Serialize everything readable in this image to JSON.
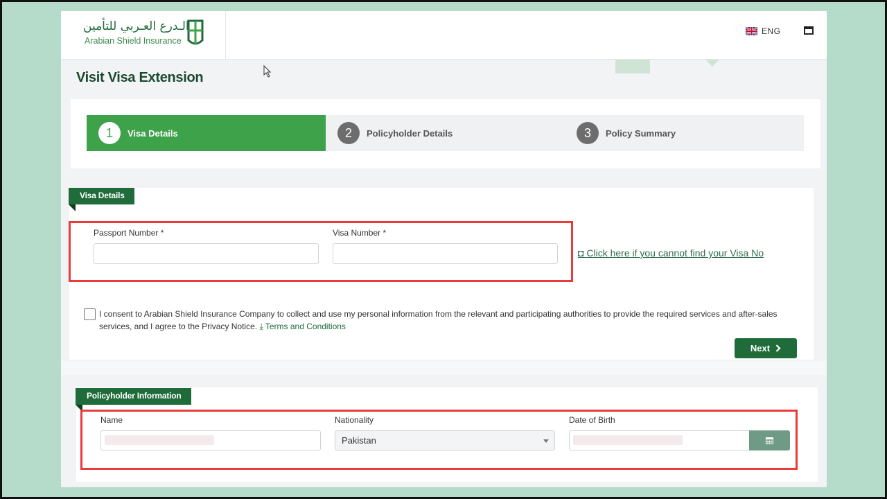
{
  "brand": {
    "name_ar": "الـدرع العـربي للتأمين",
    "name_en": "Arabian Shield Insurance"
  },
  "header": {
    "language": "ENG",
    "flag_icon": "uk-flag-icon",
    "window_icon": "window-icon"
  },
  "page_title": "Visit Visa Extension",
  "steps": [
    {
      "number": "1",
      "label": "Visa Details",
      "active": true
    },
    {
      "number": "2",
      "label": "Policyholder Details",
      "active": false
    },
    {
      "number": "3",
      "label": "Policy Summary",
      "active": false
    }
  ],
  "visa_details": {
    "section_title": "Visa Details",
    "passport_label": "Passport Number *",
    "passport_value": "",
    "visa_label": "Visa Number *",
    "visa_value": "",
    "visa_help_link": "Click here if you cannot find your Visa No",
    "consent_text": "I consent to Arabian Shield Insurance Company to collect and use my personal information from the relevant and participating authorities to provide the required services and after-sales services, and I agree to the Privacy Notice.",
    "terms_link": "Terms and Conditions",
    "consent_checked": false,
    "next_button": "Next"
  },
  "policyholder": {
    "section_title": "Policyholder Information",
    "name_label": "Name",
    "nationality_label": "Nationality",
    "nationality_value": "Pakistan",
    "dob_label": "Date of Birth"
  },
  "colors": {
    "brand_green": "#1f6b3a",
    "step_active": "#3ea24a",
    "highlight": "#ea3a3a",
    "background": "#b5dccb"
  }
}
